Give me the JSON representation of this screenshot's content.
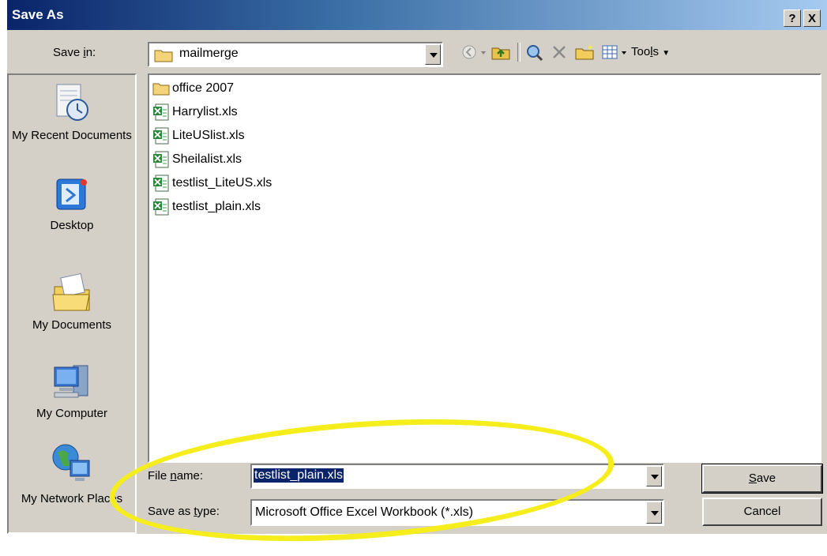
{
  "window": {
    "title": "Save As",
    "help_btn": "?",
    "close_btn": "X"
  },
  "save_in": {
    "label_pre": "Save ",
    "label_u": "i",
    "label_post": "n:",
    "value": "mailmerge"
  },
  "toolbar": {
    "tools_pre": "Too",
    "tools_u": "l",
    "tools_post": "s"
  },
  "places": [
    {
      "label": "My Recent Documents",
      "icon": "recent-documents-icon"
    },
    {
      "label": "Desktop",
      "icon": "desktop-icon"
    },
    {
      "label": "My Documents",
      "icon": "my-documents-icon"
    },
    {
      "label": "My Computer",
      "icon": "my-computer-icon"
    },
    {
      "label": "My Network Places",
      "icon": "network-places-icon"
    }
  ],
  "files": [
    {
      "name": "office 2007",
      "type": "folder"
    },
    {
      "name": "Harrylist.xls",
      "type": "excel"
    },
    {
      "name": "LiteUSlist.xls",
      "type": "excel"
    },
    {
      "name": "Sheilalist.xls",
      "type": "excel"
    },
    {
      "name": "testlist_LiteUS.xls",
      "type": "excel"
    },
    {
      "name": "testlist_plain.xls",
      "type": "excel"
    }
  ],
  "file_name": {
    "label_pre": "File ",
    "label_u": "n",
    "label_post": "ame:",
    "value": "testlist_plain.xls"
  },
  "save_type": {
    "label_pre": "Save as ",
    "label_u": "t",
    "label_post": "ype:",
    "value": "Microsoft Office Excel Workbook (*.xls)"
  },
  "buttons": {
    "save_u": "S",
    "save_rest": "ave",
    "cancel": "Cancel"
  },
  "colors": {
    "dialog_bg": "#d4d0c8",
    "title_bar": "#0a246a",
    "highlight": "#f5ee1c"
  }
}
